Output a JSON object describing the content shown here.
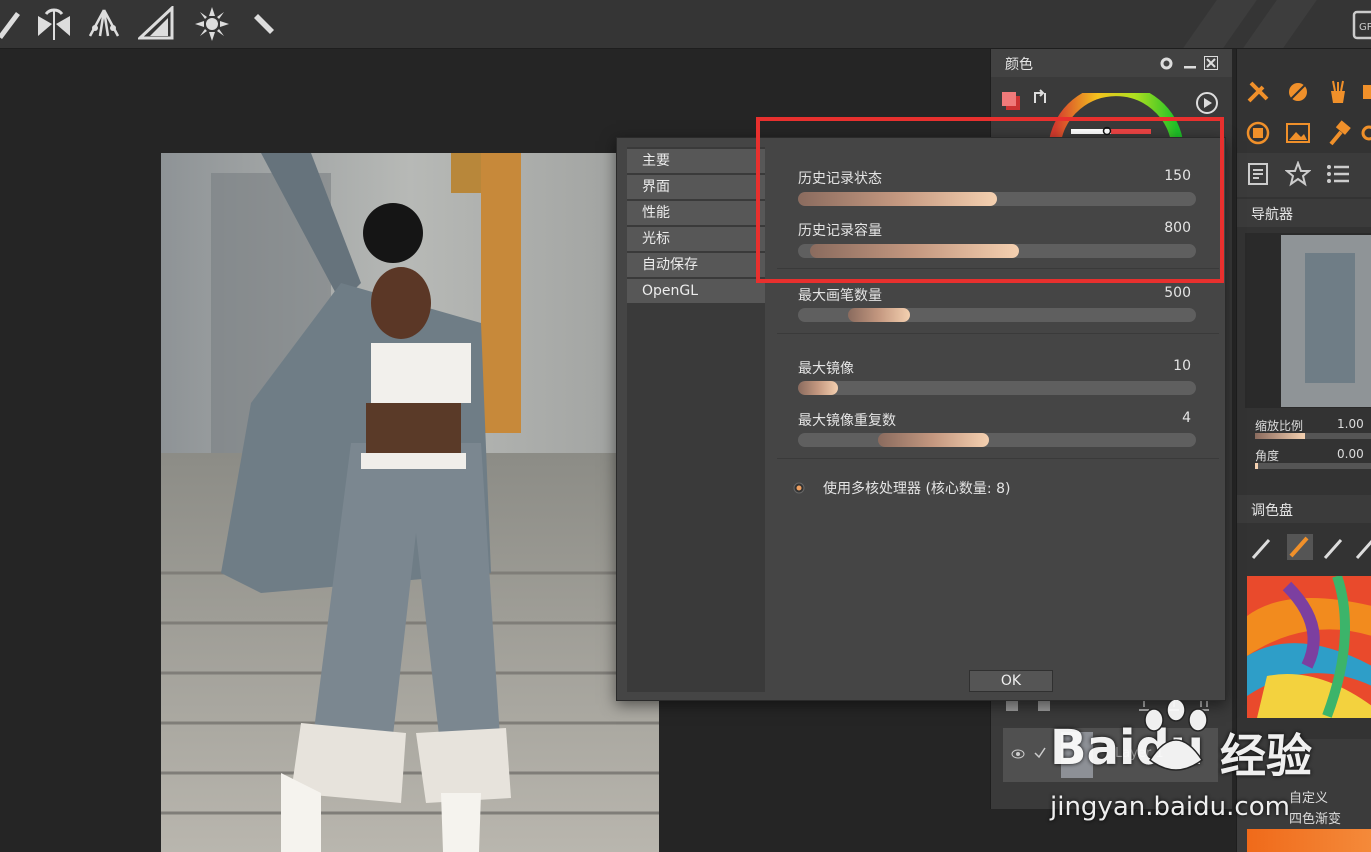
{
  "color_panel": {
    "title": "颜色"
  },
  "navigator": {
    "title": "导航器",
    "zoom_label": "缩放比例",
    "zoom_value": "1.00",
    "angle_label": "角度",
    "angle_value": "0.00"
  },
  "palette": {
    "title": "调色盘",
    "item_custom": "自定义",
    "item_gradient": "四色渐变"
  },
  "layers": {
    "layer_name": "Layer 1"
  },
  "dialog": {
    "nav": [
      "主要",
      "界面",
      "性能",
      "光标",
      "自动保存",
      "OpenGL"
    ],
    "settings": [
      {
        "label": "历史记录状态",
        "value": "150",
        "fill": 0.5
      },
      {
        "label": "历史记录容量",
        "value": "800",
        "fill": 0.54
      },
      {
        "label": "最大画笔数量",
        "value": "500",
        "fill": 0.25
      },
      {
        "label": "最大镜像",
        "value": "10",
        "fill": 0.1
      },
      {
        "label": "最大镜像重复数",
        "value": "4",
        "fill": 0.4
      }
    ],
    "multicore_label": "使用多核处理器 (核心数量: 8)",
    "ok_label": "OK"
  },
  "watermark": {
    "brand": "Baidu",
    "brand_cn": "经验",
    "url": "jingyan.baidu.com"
  },
  "colors": {
    "highlight": "#e8302e",
    "accent": "#f08a2a",
    "slider_fill": "#f4d0b0"
  }
}
